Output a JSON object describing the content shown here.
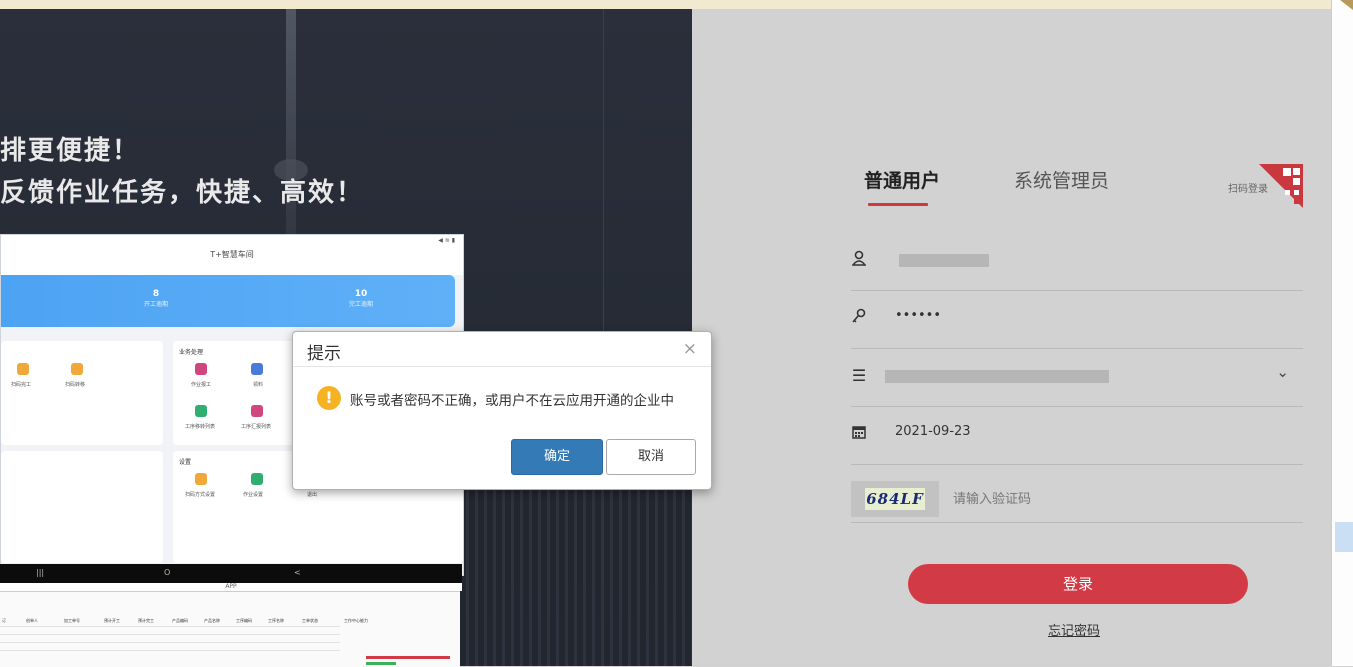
{
  "promo": {
    "headline_1": "排更便捷！",
    "headline_2": "反馈作业任务，快捷、高效！",
    "tablet": {
      "app_title": "T+智慧车间",
      "status_icons": "◀ ≋ ▮",
      "stat_1_value": "8",
      "stat_1_label": "开工逾期",
      "stat_2_value": "10",
      "stat_2_label": "完工逾期",
      "items_left": [
        "扫码完工",
        "扫码转移"
      ],
      "card_business_title": "业务处理",
      "business_items": [
        "作业报工",
        "领料",
        "工序移转列表",
        "工序汇报列表"
      ],
      "card_settings_title": "设置",
      "settings_items": [
        "扫码方式设置",
        "作业设置",
        "退出"
      ],
      "nav_glyphs": [
        "|||",
        "O",
        "<"
      ],
      "appbar_text": "APP"
    },
    "desktop_headers": [
      "订",
      "创单人",
      "加工单号",
      "预计开工",
      "预计完工",
      "产品编码",
      "产品名称",
      "工序编码",
      "工序名称",
      "工单状态"
    ],
    "desktop_side_title": "工作中心能力"
  },
  "login": {
    "tab_active": "普通用户",
    "tab_inactive": "系统管理员",
    "scan_login": "扫码登录",
    "password_mask": "••••••",
    "date_value": "2021-09-23",
    "captcha_code": "684LF",
    "captcha_placeholder": "请输入验证码",
    "login_button": "登录",
    "forgot_password": "忘记密码"
  },
  "dialog": {
    "title": "提示",
    "close": "×",
    "message": "账号或者密码不正确，或用户不在云应用开通的企业中",
    "ok": "确定",
    "cancel": "取消"
  },
  "colors": {
    "accent_red": "#d23a45",
    "ok_blue": "#337ab7",
    "warning": "#f5b324"
  }
}
